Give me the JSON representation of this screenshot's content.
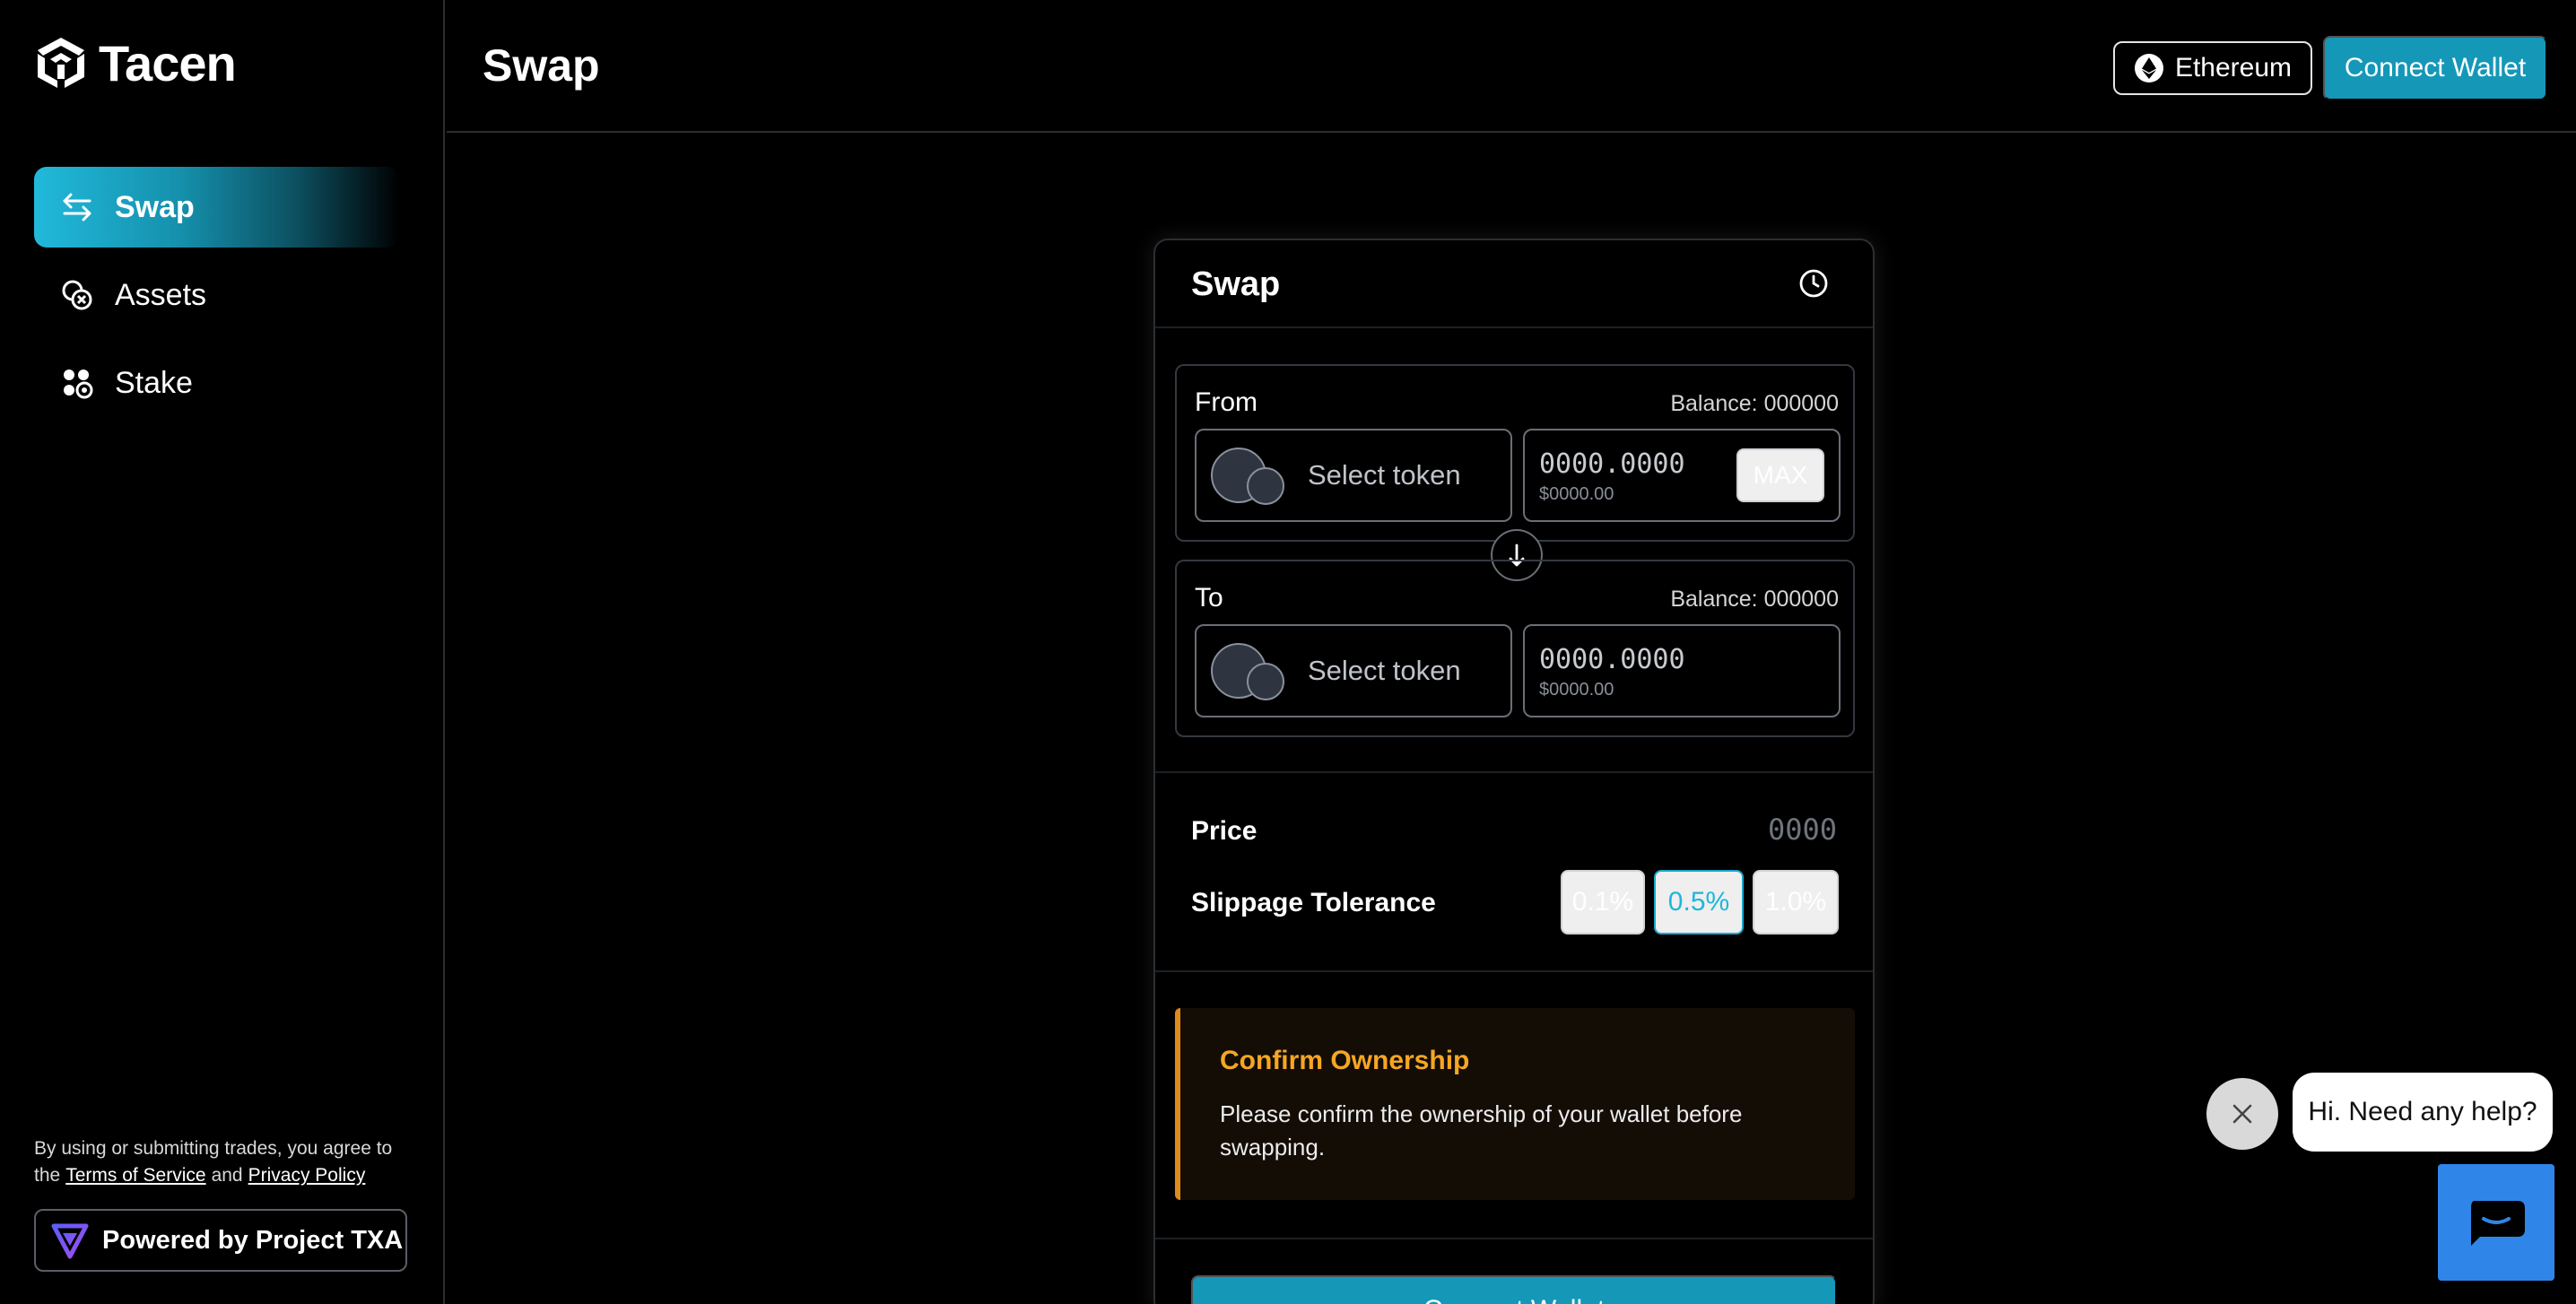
{
  "brand": {
    "name": "Tacen"
  },
  "sidebar": {
    "items": [
      {
        "label": "Swap",
        "icon": "swap-arrows-icon",
        "active": true
      },
      {
        "label": "Assets",
        "icon": "coins-icon",
        "active": false
      },
      {
        "label": "Stake",
        "icon": "stake-icon",
        "active": false
      }
    ],
    "legal": {
      "text_before": "By using or submitting trades, you agree to the",
      "terms_link": "Terms of Service",
      "and_word": "and",
      "privacy_link": "Privacy Policy"
    },
    "powered_by": "Powered by Project TXA"
  },
  "header": {
    "title": "Swap",
    "network_label": "Ethereum",
    "connect_label": "Connect Wallet"
  },
  "swap": {
    "title": "Swap",
    "from": {
      "label": "From",
      "balance": "Balance: 000000",
      "token_placeholder": "Select token",
      "amount": "0000.0000",
      "usd": "$0000.00",
      "max_label": "MAX"
    },
    "to": {
      "label": "To",
      "balance": "Balance: 000000",
      "token_placeholder": "Select token",
      "amount": "0000.0000",
      "usd": "$0000.00"
    },
    "price_label": "Price",
    "price_value": "0000",
    "slippage_label": "Slippage Tolerance",
    "slippage_options": [
      "0.1%",
      "0.5%",
      "1.0%"
    ],
    "slippage_selected": "0.5%",
    "alert": {
      "title": "Confirm Ownership",
      "text": "Please confirm the ownership of your wallet before swapping."
    },
    "cta_label": "Connect Wallet"
  },
  "help": {
    "message": "Hi. Need any help?"
  },
  "colors": {
    "accent": "#1597b8",
    "accent_light": "#21b9db",
    "warning": "#f5a623",
    "chat_blue": "#2f86e8"
  }
}
